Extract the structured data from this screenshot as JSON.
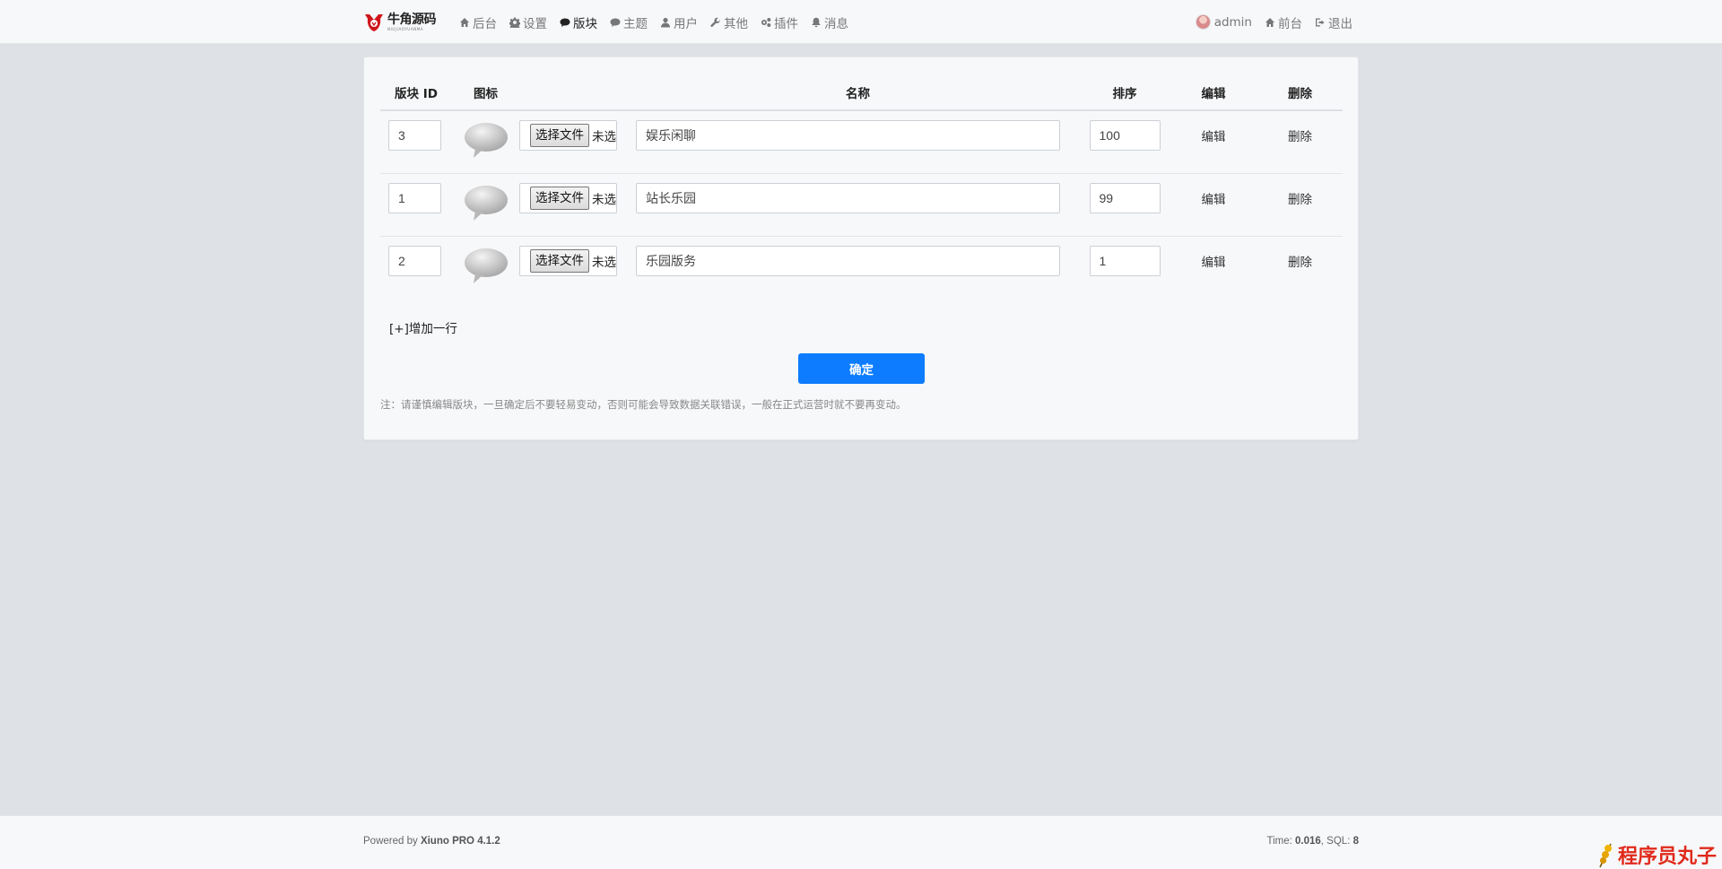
{
  "logo": {
    "main": "牛角源码",
    "sub": "NIUJIAOYUANMA"
  },
  "nav": {
    "items": [
      {
        "icon": "home-icon",
        "label": "后台"
      },
      {
        "icon": "gear-icon",
        "label": "设置"
      },
      {
        "icon": "comment-icon",
        "label": "版块"
      },
      {
        "icon": "comment-icon",
        "label": "主题"
      },
      {
        "icon": "user-icon",
        "label": "用户"
      },
      {
        "icon": "wrench-icon",
        "label": "其他"
      },
      {
        "icon": "gears-icon",
        "label": "插件"
      },
      {
        "icon": "bell-icon",
        "label": "消息"
      }
    ],
    "active_index": 2,
    "user": "admin",
    "front": "前台",
    "logout": "退出"
  },
  "table": {
    "headers": [
      "版块 ID",
      "图标",
      "名称",
      "排序",
      "编辑",
      "删除"
    ],
    "rows": [
      {
        "fid": "3",
        "name": "娱乐闲聊",
        "rank": "100"
      },
      {
        "fid": "1",
        "name": "站长乐园",
        "rank": "99"
      },
      {
        "fid": "2",
        "name": "乐园版务",
        "rank": "1"
      }
    ],
    "file_button": "选择文件",
    "file_status": "未选择任何文件",
    "edit_label": "编辑",
    "delete_label": "删除"
  },
  "add_row": "[+]增加一行",
  "submit": "确定",
  "note": "注：请谨慎编辑版块，一旦确定后不要轻易变动，否则可能会导致数据关联错误，一般在正式运营时就不要再变动。",
  "footer": {
    "powered_prefix": "Powered by ",
    "powered_name": "Xiuno PRO 4.1.2",
    "time_prefix": "Time: ",
    "time": "0.016",
    "sql_prefix": ", SQL: ",
    "sql": "8"
  },
  "watermark": "程序员丸子",
  "colors": {
    "primary": "#0d7cff",
    "background": "#dee1e6",
    "watermark": "#e02a1b"
  }
}
